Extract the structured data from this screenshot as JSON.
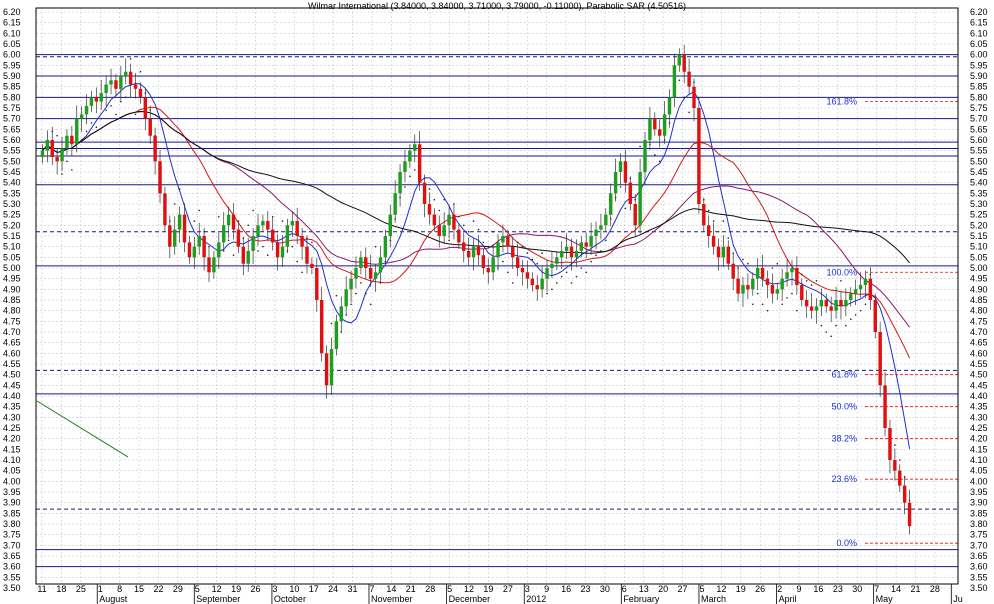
{
  "chart_data": {
    "type": "candlestick",
    "title": "Wilmar International (3.84000, 3.84000, 3.71000, 3.79000, -0.11000), Parabolic SAR (4.50516)",
    "ylim": [
      3.5,
      6.2
    ],
    "y_ticks": [
      "6.20",
      "6.15",
      "6.10",
      "6.05",
      "6.00",
      "5.95",
      "5.90",
      "5.85",
      "5.80",
      "5.75",
      "5.70",
      "5.65",
      "5.60",
      "5.55",
      "5.50",
      "5.45",
      "5.40",
      "5.35",
      "5.30",
      "5.25",
      "5.20",
      "5.15",
      "5.10",
      "5.05",
      "5.00",
      "4.95",
      "4.90",
      "4.85",
      "4.80",
      "4.75",
      "4.70",
      "4.65",
      "4.60",
      "4.55",
      "4.50",
      "4.45",
      "4.40",
      "4.35",
      "4.30",
      "4.25",
      "4.20",
      "4.15",
      "4.10",
      "4.05",
      "4.00",
      "3.95",
      "3.90",
      "3.85",
      "3.80",
      "3.75",
      "3.70",
      "3.65",
      "3.60",
      "3.55",
      "3.50"
    ],
    "x_day_labels": [
      "11",
      "18",
      "25",
      "1",
      "8",
      "15",
      "22",
      "29",
      "5",
      "12",
      "19",
      "26",
      "3",
      "10",
      "17",
      "24",
      "31",
      "7",
      "14",
      "21",
      "28",
      "5",
      "12",
      "19",
      "27",
      "3",
      "9",
      "16",
      "23",
      "30",
      "6",
      "13",
      "20",
      "27",
      "5",
      "12",
      "19",
      "26",
      "2",
      "9",
      "16",
      "23",
      "30",
      "7",
      "14",
      "21",
      "28"
    ],
    "x_month_labels": [
      "August",
      "September",
      "October",
      "November",
      "December",
      "2012",
      "February",
      "March",
      "April",
      "May",
      "Ju"
    ],
    "grid": true,
    "horizontal_levels": [
      {
        "value": 6.0,
        "style": "solid"
      },
      {
        "value": 5.99,
        "style": "dashed"
      },
      {
        "value": 5.9,
        "style": "solid"
      },
      {
        "value": 5.8,
        "style": "solid"
      },
      {
        "value": 5.7,
        "style": "solid"
      },
      {
        "value": 5.59,
        "style": "solid"
      },
      {
        "value": 5.56,
        "style": "solid"
      },
      {
        "value": 5.525,
        "style": "solid"
      },
      {
        "value": 5.39,
        "style": "solid"
      },
      {
        "value": 5.17,
        "style": "dashed"
      },
      {
        "value": 5.01,
        "style": "solid"
      },
      {
        "value": 4.52,
        "style": "dashed"
      },
      {
        "value": 4.41,
        "style": "solid"
      },
      {
        "value": 3.87,
        "style": "dashed"
      },
      {
        "value": 3.68,
        "style": "solid"
      },
      {
        "value": 3.6,
        "style": "solid"
      }
    ],
    "fibonacci": [
      {
        "label": "161.8%",
        "value": 5.78
      },
      {
        "label": "100.0%",
        "value": 4.98
      },
      {
        "label": "61.8%",
        "value": 4.5
      },
      {
        "label": "50.0%",
        "value": 4.35
      },
      {
        "label": "38.2%",
        "value": 4.2
      },
      {
        "label": "23.6%",
        "value": 4.01
      },
      {
        "label": "0.0%",
        "value": 3.71
      }
    ],
    "candles_close": [
      5.55,
      5.6,
      5.52,
      5.5,
      5.56,
      5.62,
      5.58,
      5.7,
      5.72,
      5.76,
      5.8,
      5.78,
      5.82,
      5.86,
      5.88,
      5.84,
      5.9,
      5.92,
      5.86,
      5.84,
      5.8,
      5.7,
      5.62,
      5.5,
      5.35,
      5.2,
      5.1,
      5.18,
      5.25,
      5.12,
      5.05,
      5.1,
      5.15,
      5.05,
      4.98,
      5.05,
      5.12,
      5.2,
      5.25,
      5.18,
      5.1,
      5.02,
      5.08,
      5.15,
      5.2,
      5.22,
      5.18,
      5.12,
      5.05,
      5.1,
      5.2,
      5.22,
      5.15,
      5.1,
      5.02,
      5.0,
      4.85,
      4.6,
      4.45,
      4.62,
      4.75,
      4.82,
      4.9,
      4.95,
      5.0,
      5.05,
      5.0,
      4.95,
      4.98,
      5.05,
      5.15,
      5.25,
      5.35,
      5.45,
      5.5,
      5.55,
      5.58,
      5.4,
      5.3,
      5.25,
      5.2,
      5.15,
      5.2,
      5.25,
      5.18,
      5.12,
      5.08,
      5.05,
      5.1,
      5.06,
      5.0,
      4.98,
      5.05,
      5.12,
      5.15,
      5.1,
      5.05,
      5.0,
      4.98,
      4.95,
      4.92,
      4.9,
      4.95,
      5.0,
      5.02,
      5.05,
      5.08,
      5.1,
      5.05,
      5.08,
      5.12,
      5.1,
      5.15,
      5.18,
      5.2,
      5.25,
      5.35,
      5.45,
      5.5,
      5.4,
      5.3,
      5.2,
      5.45,
      5.6,
      5.7,
      5.65,
      5.62,
      5.72,
      5.8,
      5.95,
      6.0,
      5.92,
      5.85,
      5.75,
      5.3,
      5.2,
      5.15,
      5.1,
      5.05,
      5.1,
      5.02,
      4.95,
      4.88,
      4.92,
      4.9,
      4.95,
      5.0,
      4.95,
      4.92,
      4.88,
      4.9,
      4.95,
      4.98,
      5.0,
      4.92,
      4.85,
      4.82,
      4.8,
      4.82,
      4.85,
      4.82,
      4.8,
      4.85,
      4.82,
      4.85,
      4.88,
      4.9,
      4.92,
      4.95,
      4.85,
      4.7,
      4.45,
      4.25,
      4.1,
      4.05,
      3.98,
      3.9,
      3.79
    ]
  }
}
